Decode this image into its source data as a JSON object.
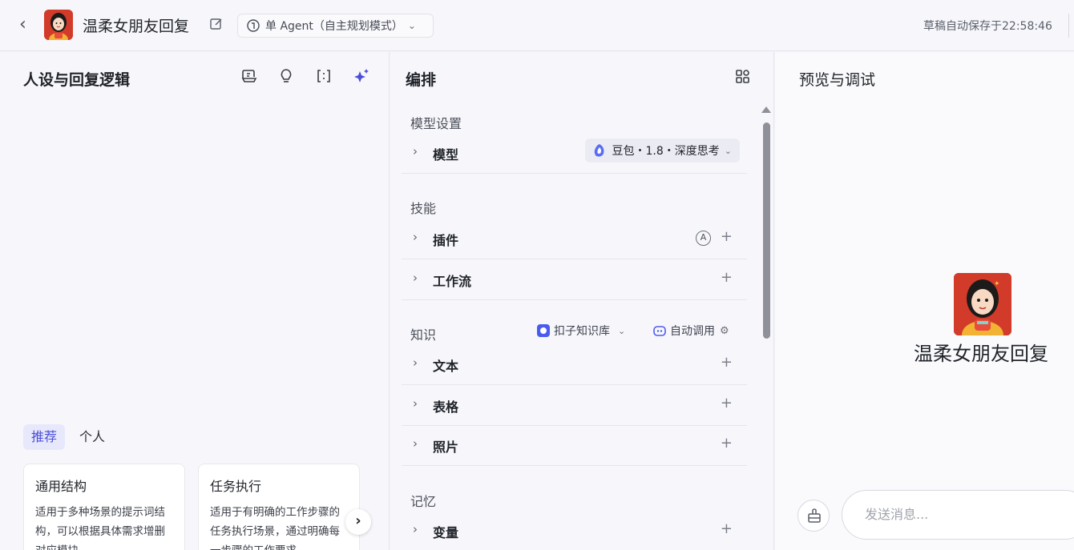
{
  "header": {
    "back_icon": "chevron-left-icon",
    "title": "温柔女朋友回复",
    "mode_label": "单 Agent（自主规划模式）",
    "autosave": "草稿自动保存于22:58:46"
  },
  "left_panel": {
    "title": "人设与回复逻辑",
    "tool_icons": [
      "prompt-library-icon",
      "lightbulb-icon",
      "brackets-icon",
      "sparkle-icon"
    ],
    "tabs": [
      {
        "label": "推荐",
        "active": true
      },
      {
        "label": "个人",
        "active": false
      }
    ],
    "cards": [
      {
        "title": "通用结构",
        "desc": "适用于多种场景的提示词结构，可以根据具体需求增删对应模块"
      },
      {
        "title": "任务执行",
        "desc": "适用于有明确的工作步骤的任务执行场景，通过明确每一步骤的工作要求"
      }
    ]
  },
  "mid_panel": {
    "title": "编排",
    "sections": {
      "model_settings": "模型设置",
      "skills": "技能",
      "knowledge": "知识",
      "memory": "记忆"
    },
    "rows": {
      "model": "模型",
      "plugin": "插件",
      "workflow": "工作流",
      "text": "文本",
      "table": "表格",
      "photo": "照片",
      "variable": "变量"
    },
    "model_value": "豆包・1.8・深度思考",
    "plugin_badge": "A",
    "plus": "+",
    "kb_source": "扣子知识库",
    "kb_call": "自动调用"
  },
  "right_panel": {
    "title": "预览与调试",
    "bot_name": "温柔女朋友回复",
    "input_placeholder": "发送消息..."
  },
  "colors": {
    "accent": "#4b4fd6",
    "avatar_bg": "#d23b2a"
  }
}
